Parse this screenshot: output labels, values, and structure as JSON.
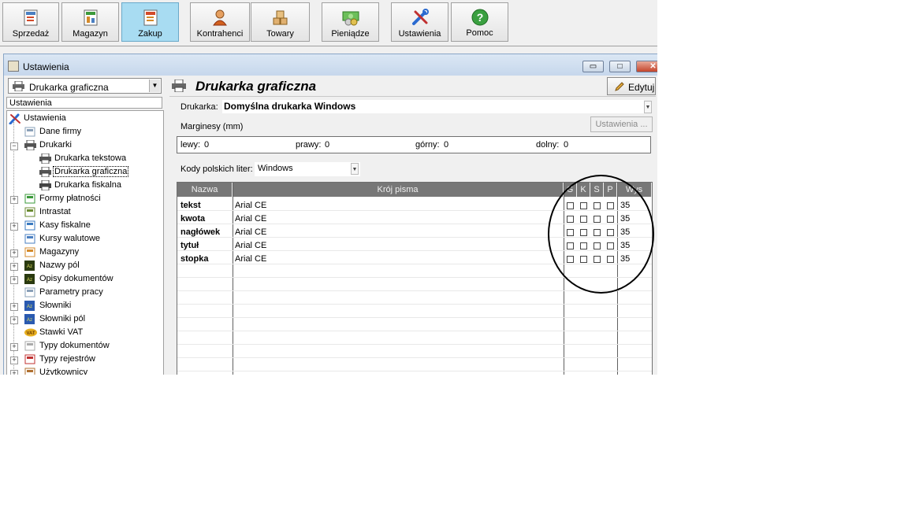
{
  "toolbar": {
    "buttons": [
      {
        "label": "Sprzedaż",
        "icon": "sales-icon"
      },
      {
        "label": "Magazyn",
        "icon": "warehouse-icon"
      },
      {
        "label": "Zakup",
        "icon": "purchase-icon",
        "active": true
      },
      {
        "label": "Kontrahenci",
        "icon": "contractors-icon"
      },
      {
        "label": "Towary",
        "icon": "goods-icon"
      },
      {
        "label": "Pieniądze",
        "icon": "money-icon"
      },
      {
        "label": "Ustawienia",
        "icon": "tools-icon"
      },
      {
        "label": "Pomoc",
        "icon": "help-icon"
      }
    ]
  },
  "window": {
    "title": "Ustawienia",
    "minimize": "▭",
    "maximize": "□",
    "close": "✕"
  },
  "left": {
    "combo_value": "Drukarka graficzna",
    "header": "Ustawienia",
    "tree": [
      {
        "label": "Ustawienia",
        "level": 0,
        "icon": "tools-icon"
      },
      {
        "label": "Dane firmy",
        "level": 1,
        "icon": "company-icon"
      },
      {
        "label": "Drukarki",
        "level": 1,
        "icon": "printer-icon",
        "expander": "−"
      },
      {
        "label": "Drukarka tekstowa",
        "level": 2,
        "icon": "printer-icon"
      },
      {
        "label": "Drukarka graficzna",
        "level": 2,
        "icon": "printer-icon",
        "selected": true
      },
      {
        "label": "Drukarka fiskalna",
        "level": 2,
        "icon": "fiscal-printer-icon"
      },
      {
        "label": "Formy płatności",
        "level": 1,
        "icon": "payment-icon",
        "expander": "+"
      },
      {
        "label": "Intrastat",
        "level": 1,
        "icon": "intrastat-icon"
      },
      {
        "label": "Kasy fiskalne",
        "level": 1,
        "icon": "cash-register-icon",
        "expander": "+"
      },
      {
        "label": "Kursy walutowe",
        "level": 1,
        "icon": "currency-chart-icon"
      },
      {
        "label": "Magazyny",
        "level": 1,
        "icon": "warehouse-icon",
        "expander": "+"
      },
      {
        "label": "Nazwy pól",
        "level": 1,
        "icon": "dictionary-icon",
        "expander": "+"
      },
      {
        "label": "Opisy dokumentów",
        "level": 1,
        "icon": "dictionary-icon",
        "expander": "+"
      },
      {
        "label": "Parametry pracy",
        "level": 1,
        "icon": "parameters-icon"
      },
      {
        "label": "Słowniki",
        "level": 1,
        "icon": "dictionary-blue-icon",
        "expander": "+"
      },
      {
        "label": "Słowniki pól",
        "level": 1,
        "icon": "dictionary-blue-icon",
        "expander": "+"
      },
      {
        "label": "Stawki VAT",
        "level": 1,
        "icon": "vat-icon"
      },
      {
        "label": "Typy dokumentów",
        "level": 1,
        "icon": "document-types-icon",
        "expander": "+"
      },
      {
        "label": "Typy rejestrów",
        "level": 1,
        "icon": "registers-icon",
        "expander": "+"
      },
      {
        "label": "Użytkownicy",
        "level": 1,
        "icon": "users-icon",
        "expander": "+"
      }
    ]
  },
  "right": {
    "title": "Drukarka graficzna",
    "edit_label": "Edytuj",
    "printer_label": "Drukarka:",
    "printer_value": "Domyślna drukarka Windows",
    "margins_label": "Marginesy (mm)",
    "settings_button": "Ustawienia ...",
    "margins": [
      {
        "label": "lewy:",
        "value": "0"
      },
      {
        "label": "prawy:",
        "value": "0"
      },
      {
        "label": "górny:",
        "value": "0"
      },
      {
        "label": "dolny:",
        "value": "0"
      }
    ],
    "codes_label": "Kody polskich liter:",
    "codes_value": "Windows",
    "grid": {
      "columns": [
        "Nazwa",
        "Krój pisma",
        "G",
        "K",
        "S",
        "P",
        "Wys"
      ],
      "rows": [
        {
          "name": "tekst",
          "font": "Arial CE",
          "g": false,
          "k": false,
          "s": false,
          "p": false,
          "height": "35"
        },
        {
          "name": "kwota",
          "font": "Arial CE",
          "g": false,
          "k": false,
          "s": false,
          "p": false,
          "height": "35"
        },
        {
          "name": "nagłówek",
          "font": "Arial CE",
          "g": false,
          "k": false,
          "s": false,
          "p": false,
          "height": "35"
        },
        {
          "name": "tytuł",
          "font": "Arial CE",
          "g": false,
          "k": false,
          "s": false,
          "p": false,
          "height": "35"
        },
        {
          "name": "stopka",
          "font": "Arial CE",
          "g": false,
          "k": false,
          "s": false,
          "p": false,
          "height": "35"
        }
      ]
    }
  }
}
